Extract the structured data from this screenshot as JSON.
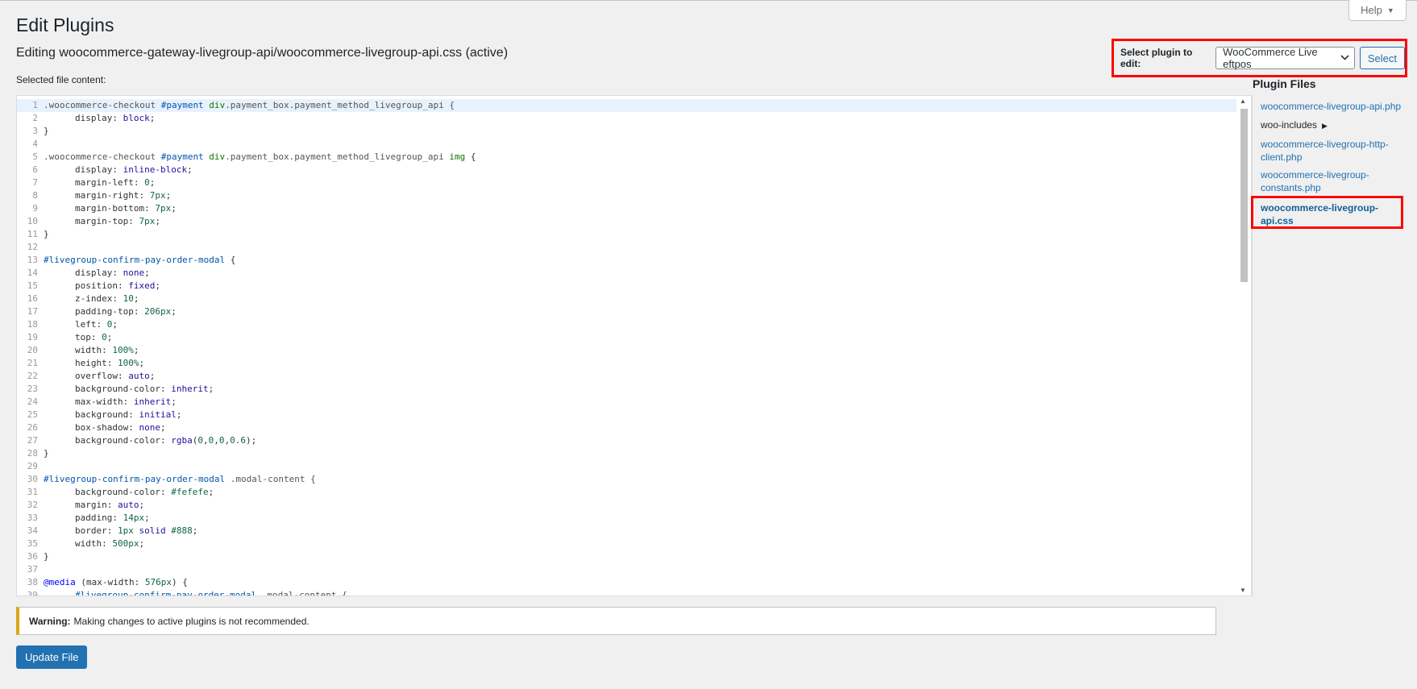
{
  "header": {
    "page_title": "Edit Plugins",
    "help_label": "Help",
    "editing_title": "Editing woocommerce-gateway-livegroup-api/woocommerce-livegroup-api.css (active)",
    "selected_file_label": "Selected file content:"
  },
  "plugin_selector": {
    "label": "Select plugin to edit:",
    "selected_value": "WooCommerce Live eftpos",
    "button_label": "Select"
  },
  "plugin_files": {
    "title": "Plugin Files",
    "items": [
      {
        "label": "woocommerce-livegroup-api.php"
      },
      {
        "label": "woo-includes"
      },
      {
        "label": "woocommerce-livegroup-http-client.php",
        "line1": "woocommerce-livegroup-http-",
        "line2": "client.php"
      },
      {
        "label": "woocommerce-livegroup-constants.php",
        "line1": "woocommerce-livegroup-",
        "line2": "constants.php"
      },
      {
        "label": "woocommerce-livegroup-api.css",
        "line1": "woocommerce-livegroup-",
        "line2": "api.css"
      }
    ]
  },
  "code": {
    "lines": [
      {
        "n": "1",
        "indent": 0,
        "tokens": [
          {
            "t": ".woocommerce-checkout ",
            "c": "sel"
          },
          {
            "t": "#payment",
            "c": "id"
          },
          {
            "t": " div",
            "c": "tag"
          },
          {
            "t": ".payment_box.payment_method_livegroup_api {",
            "c": "sel"
          }
        ]
      },
      {
        "n": "2",
        "indent": 1,
        "tokens": [
          {
            "t": "display: ",
            "c": "prop"
          },
          {
            "t": "block",
            "c": "atom"
          },
          {
            "t": ";",
            "c": "prop"
          }
        ]
      },
      {
        "n": "3",
        "indent": 0,
        "tokens": [
          {
            "t": "}",
            "c": "prop"
          }
        ]
      },
      {
        "n": "4",
        "indent": 0,
        "tokens": []
      },
      {
        "n": "5",
        "indent": 0,
        "tokens": [
          {
            "t": ".woocommerce-checkout ",
            "c": "sel"
          },
          {
            "t": "#payment",
            "c": "id"
          },
          {
            "t": " div",
            "c": "tag"
          },
          {
            "t": ".payment_box.payment_method_livegroup_api ",
            "c": "sel"
          },
          {
            "t": "img",
            "c": "tag"
          },
          {
            "t": " {",
            "c": "prop"
          }
        ]
      },
      {
        "n": "6",
        "indent": 1,
        "tokens": [
          {
            "t": "display: ",
            "c": "prop"
          },
          {
            "t": "inline-block",
            "c": "atom"
          },
          {
            "t": ";",
            "c": "prop"
          }
        ]
      },
      {
        "n": "7",
        "indent": 1,
        "tokens": [
          {
            "t": "margin-left: ",
            "c": "prop"
          },
          {
            "t": "0",
            "c": "num"
          },
          {
            "t": ";",
            "c": "prop"
          }
        ]
      },
      {
        "n": "8",
        "indent": 1,
        "tokens": [
          {
            "t": "margin-right: ",
            "c": "prop"
          },
          {
            "t": "7px",
            "c": "num"
          },
          {
            "t": ";",
            "c": "prop"
          }
        ]
      },
      {
        "n": "9",
        "indent": 1,
        "tokens": [
          {
            "t": "margin-bottom: ",
            "c": "prop"
          },
          {
            "t": "7px",
            "c": "num"
          },
          {
            "t": ";",
            "c": "prop"
          }
        ]
      },
      {
        "n": "10",
        "indent": 1,
        "tokens": [
          {
            "t": "margin-top: ",
            "c": "prop"
          },
          {
            "t": "7px",
            "c": "num"
          },
          {
            "t": ";",
            "c": "prop"
          }
        ]
      },
      {
        "n": "11",
        "indent": 0,
        "tokens": [
          {
            "t": "}",
            "c": "prop"
          }
        ]
      },
      {
        "n": "12",
        "indent": 0,
        "tokens": []
      },
      {
        "n": "13",
        "indent": 0,
        "tokens": [
          {
            "t": "#livegroup-confirm-pay-order-modal",
            "c": "id"
          },
          {
            "t": " {",
            "c": "prop"
          }
        ]
      },
      {
        "n": "14",
        "indent": 1,
        "tokens": [
          {
            "t": "display: ",
            "c": "prop"
          },
          {
            "t": "none",
            "c": "atom"
          },
          {
            "t": ";",
            "c": "prop"
          }
        ]
      },
      {
        "n": "15",
        "indent": 1,
        "tokens": [
          {
            "t": "position: ",
            "c": "prop"
          },
          {
            "t": "fixed",
            "c": "atom"
          },
          {
            "t": ";",
            "c": "prop"
          }
        ]
      },
      {
        "n": "16",
        "indent": 1,
        "tokens": [
          {
            "t": "z-index: ",
            "c": "prop"
          },
          {
            "t": "10",
            "c": "num"
          },
          {
            "t": ";",
            "c": "prop"
          }
        ]
      },
      {
        "n": "17",
        "indent": 1,
        "tokens": [
          {
            "t": "padding-top: ",
            "c": "prop"
          },
          {
            "t": "206px",
            "c": "num"
          },
          {
            "t": ";",
            "c": "prop"
          }
        ]
      },
      {
        "n": "18",
        "indent": 1,
        "tokens": [
          {
            "t": "left: ",
            "c": "prop"
          },
          {
            "t": "0",
            "c": "num"
          },
          {
            "t": ";",
            "c": "prop"
          }
        ]
      },
      {
        "n": "19",
        "indent": 1,
        "tokens": [
          {
            "t": "top: ",
            "c": "prop"
          },
          {
            "t": "0",
            "c": "num"
          },
          {
            "t": ";",
            "c": "prop"
          }
        ]
      },
      {
        "n": "20",
        "indent": 1,
        "tokens": [
          {
            "t": "width: ",
            "c": "prop"
          },
          {
            "t": "100%",
            "c": "num"
          },
          {
            "t": ";",
            "c": "prop"
          }
        ]
      },
      {
        "n": "21",
        "indent": 1,
        "tokens": [
          {
            "t": "height: ",
            "c": "prop"
          },
          {
            "t": "100%",
            "c": "num"
          },
          {
            "t": ";",
            "c": "prop"
          }
        ]
      },
      {
        "n": "22",
        "indent": 1,
        "tokens": [
          {
            "t": "overflow: ",
            "c": "prop"
          },
          {
            "t": "auto",
            "c": "atom"
          },
          {
            "t": ";",
            "c": "prop"
          }
        ]
      },
      {
        "n": "23",
        "indent": 1,
        "tokens": [
          {
            "t": "background-color: ",
            "c": "prop"
          },
          {
            "t": "inherit",
            "c": "atom"
          },
          {
            "t": ";",
            "c": "prop"
          }
        ]
      },
      {
        "n": "24",
        "indent": 1,
        "tokens": [
          {
            "t": "max-width: ",
            "c": "prop"
          },
          {
            "t": "inherit",
            "c": "atom"
          },
          {
            "t": ";",
            "c": "prop"
          }
        ]
      },
      {
        "n": "25",
        "indent": 1,
        "tokens": [
          {
            "t": "background: ",
            "c": "prop"
          },
          {
            "t": "initial",
            "c": "atom"
          },
          {
            "t": ";",
            "c": "prop"
          }
        ]
      },
      {
        "n": "26",
        "indent": 1,
        "tokens": [
          {
            "t": "box-shadow: ",
            "c": "prop"
          },
          {
            "t": "none",
            "c": "atom"
          },
          {
            "t": ";",
            "c": "prop"
          }
        ]
      },
      {
        "n": "27",
        "indent": 1,
        "tokens": [
          {
            "t": "background-color: ",
            "c": "prop"
          },
          {
            "t": "rgba",
            "c": "atom"
          },
          {
            "t": "(",
            "c": "prop"
          },
          {
            "t": "0",
            "c": "num"
          },
          {
            "t": ",",
            "c": "prop"
          },
          {
            "t": "0",
            "c": "num"
          },
          {
            "t": ",",
            "c": "prop"
          },
          {
            "t": "0",
            "c": "num"
          },
          {
            "t": ",",
            "c": "prop"
          },
          {
            "t": "0.6",
            "c": "num"
          },
          {
            "t": ");",
            "c": "prop"
          }
        ]
      },
      {
        "n": "28",
        "indent": 0,
        "tokens": [
          {
            "t": "}",
            "c": "prop"
          }
        ]
      },
      {
        "n": "29",
        "indent": 0,
        "tokens": []
      },
      {
        "n": "30",
        "indent": 0,
        "tokens": [
          {
            "t": "#livegroup-confirm-pay-order-modal",
            "c": "id"
          },
          {
            "t": " .modal-content {",
            "c": "sel"
          }
        ]
      },
      {
        "n": "31",
        "indent": 1,
        "tokens": [
          {
            "t": "background-color: ",
            "c": "prop"
          },
          {
            "t": "#fefefe",
            "c": "num"
          },
          {
            "t": ";",
            "c": "prop"
          }
        ]
      },
      {
        "n": "32",
        "indent": 1,
        "tokens": [
          {
            "t": "margin: ",
            "c": "prop"
          },
          {
            "t": "auto",
            "c": "atom"
          },
          {
            "t": ";",
            "c": "prop"
          }
        ]
      },
      {
        "n": "33",
        "indent": 1,
        "tokens": [
          {
            "t": "padding: ",
            "c": "prop"
          },
          {
            "t": "14px",
            "c": "num"
          },
          {
            "t": ";",
            "c": "prop"
          }
        ]
      },
      {
        "n": "34",
        "indent": 1,
        "tokens": [
          {
            "t": "border: ",
            "c": "prop"
          },
          {
            "t": "1px",
            "c": "num"
          },
          {
            "t": " ",
            "c": "prop"
          },
          {
            "t": "solid",
            "c": "atom"
          },
          {
            "t": " ",
            "c": "prop"
          },
          {
            "t": "#888",
            "c": "num"
          },
          {
            "t": ";",
            "c": "prop"
          }
        ]
      },
      {
        "n": "35",
        "indent": 1,
        "tokens": [
          {
            "t": "width: ",
            "c": "prop"
          },
          {
            "t": "500px",
            "c": "num"
          },
          {
            "t": ";",
            "c": "prop"
          }
        ]
      },
      {
        "n": "36",
        "indent": 0,
        "tokens": [
          {
            "t": "}",
            "c": "prop"
          }
        ]
      },
      {
        "n": "37",
        "indent": 0,
        "tokens": []
      },
      {
        "n": "38",
        "indent": 0,
        "tokens": [
          {
            "t": "@media",
            "c": "def"
          },
          {
            "t": " (max-width: ",
            "c": "prop"
          },
          {
            "t": "576px",
            "c": "num"
          },
          {
            "t": ") {",
            "c": "prop"
          }
        ]
      },
      {
        "n": "39",
        "indent": 1,
        "tokens": [
          {
            "t": "#livegroup-confirm-pay-order-modal",
            "c": "id"
          },
          {
            "t": " .modal-content {",
            "c": "sel"
          }
        ]
      }
    ]
  },
  "notice": {
    "strong": "Warning:",
    "text": "Making changes to active plugins is not recommended."
  },
  "update_button_label": "Update File",
  "colors": {
    "accent": "#2271b1",
    "highlight_box": "#ff0000",
    "warning_border": "#dba617"
  }
}
